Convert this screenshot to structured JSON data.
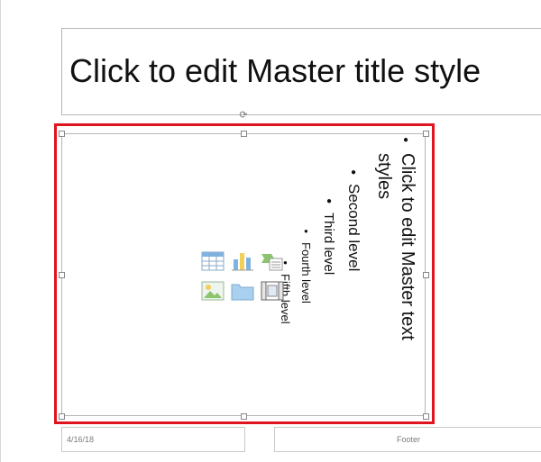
{
  "slide": {
    "title": "Click to edit Master title style",
    "body_levels": [
      "Click to edit Master text",
      "styles",
      "Second level",
      "Third level",
      "Fourth level",
      "Fifth level"
    ],
    "content_icons": [
      "table-icon",
      "chart-icon",
      "smartart-icon",
      "picture-icon",
      "folder-icon",
      "video-icon"
    ],
    "date": "4/16/18",
    "footer": "Footer"
  },
  "colors": {
    "selection": "#e0141e",
    "placeholder_border": "#b5b5b5"
  }
}
